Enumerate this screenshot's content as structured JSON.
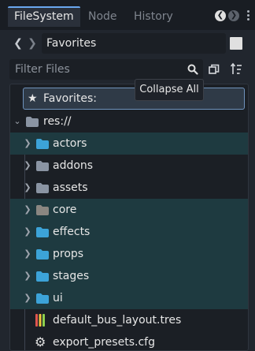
{
  "tabs": [
    {
      "label": "FileSystem",
      "active": true
    },
    {
      "label": "Node",
      "active": false
    },
    {
      "label": "History",
      "active": false
    }
  ],
  "path": {
    "value": "Favorites"
  },
  "filter": {
    "placeholder": "Filter Files",
    "value": ""
  },
  "tooltip": {
    "text": "Collapse All"
  },
  "tree": {
    "favorites_label": "Favorites:",
    "root_label": "res://",
    "items": [
      {
        "label": "actors",
        "icon": "folder-icon",
        "folder_color": "#3ca3d8",
        "highlighted": true
      },
      {
        "label": "addons",
        "icon": "folder-icon",
        "folder_color": "#8a94a3",
        "highlighted": false
      },
      {
        "label": "assets",
        "icon": "folder-icon",
        "folder_color": "#8a94a3",
        "highlighted": false
      },
      {
        "label": "core",
        "icon": "folder-icon",
        "folder_color": "#8a8681",
        "highlighted": true
      },
      {
        "label": "effects",
        "icon": "folder-icon",
        "folder_color": "#3ca3d8",
        "highlighted": true
      },
      {
        "label": "props",
        "icon": "folder-icon",
        "folder_color": "#3ca3d8",
        "highlighted": true
      },
      {
        "label": "stages",
        "icon": "folder-icon",
        "folder_color": "#3ca3d8",
        "highlighted": true
      },
      {
        "label": "ui",
        "icon": "folder-icon",
        "folder_color": "#3ca3d8",
        "highlighted": true
      }
    ],
    "files": [
      {
        "label": "default_bus_layout.tres",
        "icon": "audio-bus-layout-icon"
      },
      {
        "label": "export_presets.cfg",
        "icon": "gear-icon"
      }
    ]
  },
  "colors": {
    "accent": "#6aa7ee",
    "highlight_row": "#1e3a40",
    "folder_blue": "#3ca3d8",
    "folder_gray": "#8a94a3"
  }
}
